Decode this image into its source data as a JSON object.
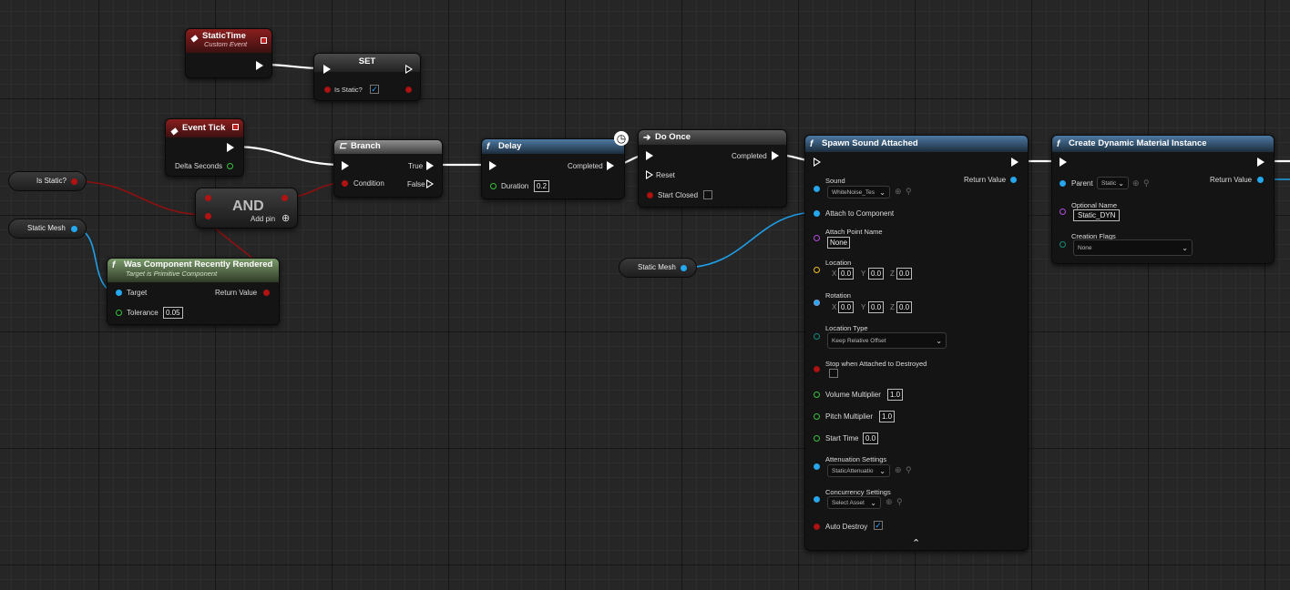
{
  "nodes": {
    "static_time": {
      "title": "StaticTime",
      "subtitle": "Custom Event"
    },
    "set_node": {
      "title": "SET",
      "pin_label": "Is Static?",
      "checked_mark": "✓"
    },
    "event_tick": {
      "title": "Event Tick",
      "delta_label": "Delta Seconds"
    },
    "branch": {
      "title": "Branch",
      "condition_label": "Condition",
      "true_label": "True",
      "false_label": "False"
    },
    "and_node": {
      "title": "AND",
      "add_pin_label": "Add pin"
    },
    "delay": {
      "title": "Delay",
      "completed_label": "Completed",
      "duration_label": "Duration",
      "duration_value": "0.2"
    },
    "do_once": {
      "title": "Do Once",
      "completed_label": "Completed",
      "reset_label": "Reset",
      "start_closed_label": "Start Closed"
    },
    "was_rendered": {
      "title": "Was Component Recently Rendered",
      "subtitle": "Target is Primitive Component",
      "target_label": "Target",
      "return_label": "Return Value",
      "tolerance_label": "Tolerance",
      "tolerance_value": "0.05"
    },
    "spawn_sound": {
      "title": "Spawn Sound Attached",
      "return_label": "Return Value",
      "sound_label": "Sound",
      "sound_value": "WhiteNoise_Tes",
      "attach_label": "Attach to Component",
      "attach_point_label": "Attach Point Name",
      "attach_point_value": "None",
      "location_label": "Location",
      "rotation_label": "Rotation",
      "axis_x": "X",
      "axis_y": "Y",
      "axis_z": "Z",
      "loc_x": "0.0",
      "loc_y": "0.0",
      "loc_z": "0.0",
      "rot_x": "0.0",
      "rot_y": "0.0",
      "rot_z": "0.0",
      "location_type_label": "Location Type",
      "location_type_value": "Keep Relative Offset",
      "stop_label": "Stop when Attached to Destroyed",
      "volume_label": "Volume Multiplier",
      "volume_value": "1.0",
      "pitch_label": "Pitch Multiplier",
      "pitch_value": "1.0",
      "start_time_label": "Start Time",
      "start_time_value": "0.0",
      "attenuation_label": "Attenuation Settings",
      "attenuation_value": "StaticAttenuatio",
      "concurrency_label": "Concurrency Settings",
      "concurrency_value": "Select Asset",
      "auto_destroy_label": "Auto Destroy",
      "auto_destroy_mark": "✓",
      "collapse_glyph": "⌃"
    },
    "create_dmi": {
      "title": "Create Dynamic Material Instance",
      "parent_label": "Parent",
      "parent_value": "Static",
      "return_label": "Return Value",
      "optional_name_label": "Optional Name",
      "optional_name_value": "Static_DYN",
      "creation_flags_label": "Creation Flags",
      "creation_flags_value": "None"
    }
  },
  "variables": {
    "is_static": "Is Static?",
    "static_mesh_left": "Static Mesh",
    "static_mesh_mid": "Static Mesh"
  },
  "icons": {
    "function": "f",
    "branch": "⊏",
    "do_once": "➔",
    "clock": "◷",
    "chevron": "⌄",
    "add": "⊕",
    "browse": "⊕",
    "search": "⚲"
  },
  "colors": {
    "exec_wire": "#ffffff",
    "bool_wire": "#8e0f0f",
    "object_wire": "#1e9fe8"
  }
}
